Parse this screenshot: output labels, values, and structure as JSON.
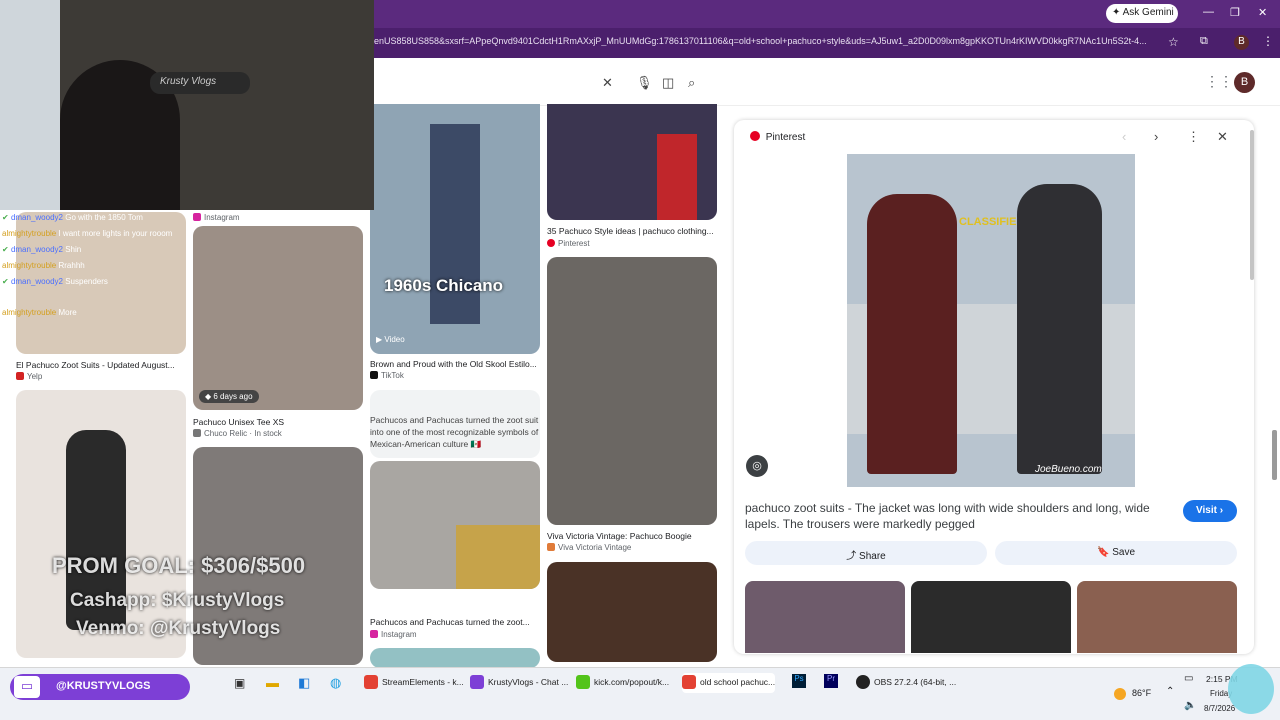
{
  "browser": {
    "url": "enUS858US858&sxsrf=APpeQnvd9401CdctH1RmAXxjP_MnUUMdGg:1786137011106&q=old+school+pachuco+style&uds=AJ5uw1_a2D0D09lxm8gpKKOTUn4rKIWVD0kkgR7NAc1Un5S2t-4...",
    "ask_gemini": "Ask Gemini",
    "profile_initial": "B"
  },
  "results": [
    {
      "caption": "El Pachuco Zoot Suits - Updated August...",
      "source": "Yelp"
    },
    {
      "caption": "Pachuco Unisex Tee XS",
      "source": "Chuco Relic · In stock",
      "badge": "6 days ago"
    },
    {
      "caption": "Brown and Proud with the Old Skool Estilo...",
      "source": "TikTok",
      "badge": "Video",
      "overlay": "1960s Chicano"
    },
    {
      "caption": "35 Pachuco Style ideas | pachuco clothing...",
      "source": "Pinterest"
    },
    {
      "caption": "Viva Victoria Vintage: Pachuco Boogie",
      "source": "Viva Victoria Vintage"
    },
    {
      "caption": "Pachucos and Pachucas turned the zoot...",
      "source": "Instagram",
      "quote": "Pachucos and Pachucas turned the zoot suit into one of the most recognizable symbols of Mexican-American culture 🇲🇽"
    },
    {
      "caption": "",
      "source": "Instagram"
    }
  ],
  "panel": {
    "source": "Pinterest",
    "title": "pachuco zoot suits - The jacket was long with wide shoulders and long, wide lapels. The trousers were markedly pegged",
    "visit": "Visit",
    "share": "Share",
    "save": "Save",
    "watermark": "JoeBueno.com",
    "car_sign": "CLASSIFIED"
  },
  "chat": [
    {
      "user": "dman_woody2",
      "msg": "Go with the 1850 Tom",
      "color": "#4a6fff"
    },
    {
      "user": "almightytrouble",
      "msg": "I want more lights in your rooom",
      "color": "#d4a020"
    },
    {
      "user": "dman_woody2",
      "msg": "Shin",
      "color": "#4a6fff"
    },
    {
      "user": "almightytrouble",
      "msg": "Rrahhh",
      "color": "#d4a020"
    },
    {
      "user": "dman_woody2",
      "msg": "Suspenders",
      "color": "#4a6fff"
    },
    {
      "user": "almightytrouble",
      "msg": "More",
      "color": "#d4a020"
    }
  ],
  "stream": {
    "prom_goal": "PROM GOAL: $306/$500",
    "cashapp": "Cashapp: $KrustyVlogs",
    "venmo": "Venmo: @KrustyVlogs",
    "twitch": "@KRUSTYVLOGS",
    "sign": "Krusty Vlogs"
  },
  "taskbar": {
    "items": [
      "StreamElements - k...",
      "KrustyVlogs - Chat ...",
      "kick.com/popout/k...",
      "old school pachuc...",
      "OBS 27.2.4 (64-bit, ..."
    ],
    "weather": "86°F",
    "time": "2:15 PM",
    "day": "Friday",
    "date": "8/7/2026"
  },
  "colors": {
    "titlebar": "#5b2a7e",
    "accent": "#1a73e8"
  }
}
